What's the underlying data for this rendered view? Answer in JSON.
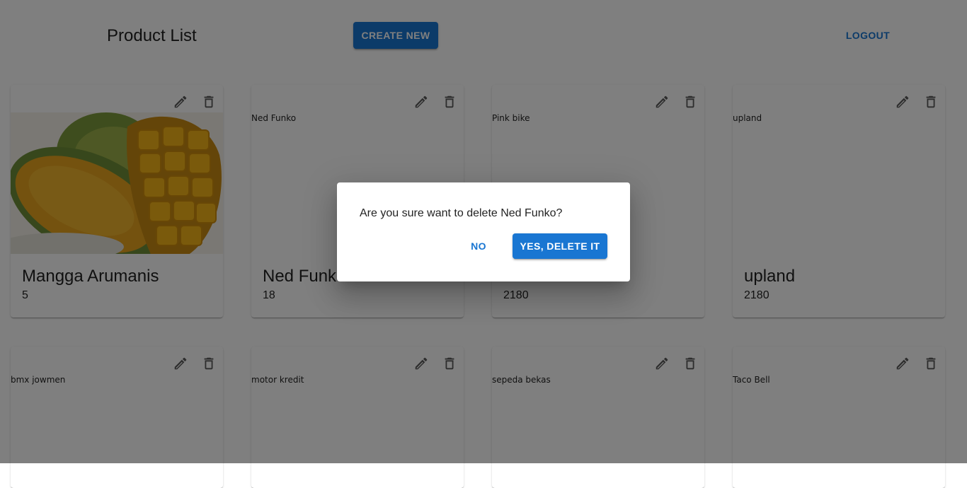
{
  "header": {
    "title": "Product List",
    "create_label": "CREATE NEW",
    "logout_label": "LOGOUT"
  },
  "icons": {
    "edit": "pencil-icon",
    "delete": "trash-icon"
  },
  "colors": {
    "primary": "#1976d2",
    "backdrop": "rgba(0,0,0,0.5)"
  },
  "products": [
    {
      "alt": "",
      "name": "Mangga Arumanis",
      "price": "5",
      "has_image": true,
      "image": "mango"
    },
    {
      "alt": "Ned Funko",
      "name": "Ned Funko",
      "price": "18"
    },
    {
      "alt": "Pink bike",
      "name": "Pink bike",
      "price": "2180"
    },
    {
      "alt": "upland",
      "name": "upland",
      "price": "2180"
    },
    {
      "alt": "bmx jowmen",
      "name": "",
      "price": ""
    },
    {
      "alt": "motor kredit",
      "name": "",
      "price": ""
    },
    {
      "alt": "sepeda bekas",
      "name": "",
      "price": ""
    },
    {
      "alt": "Taco Bell",
      "name": "",
      "price": ""
    }
  ],
  "dialog": {
    "message": "Are you sure want to delete Ned Funko?",
    "no_label": "NO",
    "yes_label": "YES, DELETE IT"
  }
}
